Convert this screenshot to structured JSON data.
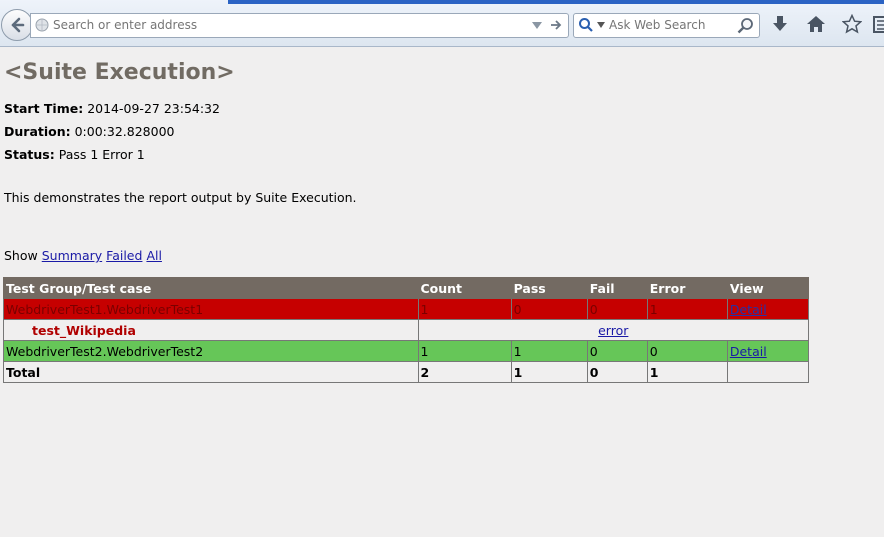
{
  "browser": {
    "address_placeholder": "Search or enter address",
    "search_placeholder": "Ask Web Search"
  },
  "page": {
    "title": "<Suite Execution>",
    "start_time_label": "Start Time:",
    "start_time_value": "2014-09-27 23:54:32",
    "duration_label": "Duration:",
    "duration_value": "0:00:32.828000",
    "status_label": "Status:",
    "status_value": "Pass 1 Error 1",
    "description": "This demonstrates the report output by Suite Execution.",
    "show_label": "Show",
    "filters": [
      "Summary",
      "Failed",
      "All"
    ]
  },
  "table": {
    "headers": [
      "Test Group/Test case",
      "Count",
      "Pass",
      "Fail",
      "Error",
      "View"
    ],
    "groups": [
      {
        "name": "WebdriverTest1.WebdriverTest1",
        "count": "1",
        "pass": "0",
        "fail": "0",
        "error": "1",
        "view": "Detail",
        "status": "error"
      },
      {
        "name": "WebdriverTest2.WebdriverTest2",
        "count": "1",
        "pass": "1",
        "fail": "0",
        "error": "0",
        "view": "Detail",
        "status": "pass"
      }
    ],
    "case": {
      "name": "test_Wikipedia",
      "result": "error"
    },
    "total": {
      "label": "Total",
      "count": "2",
      "pass": "1",
      "fail": "0",
      "error": "1"
    }
  },
  "colors": {
    "header_bg": "#736a62",
    "error_row": "#c60000",
    "pass_row": "#66c658",
    "title": "#716b63"
  }
}
